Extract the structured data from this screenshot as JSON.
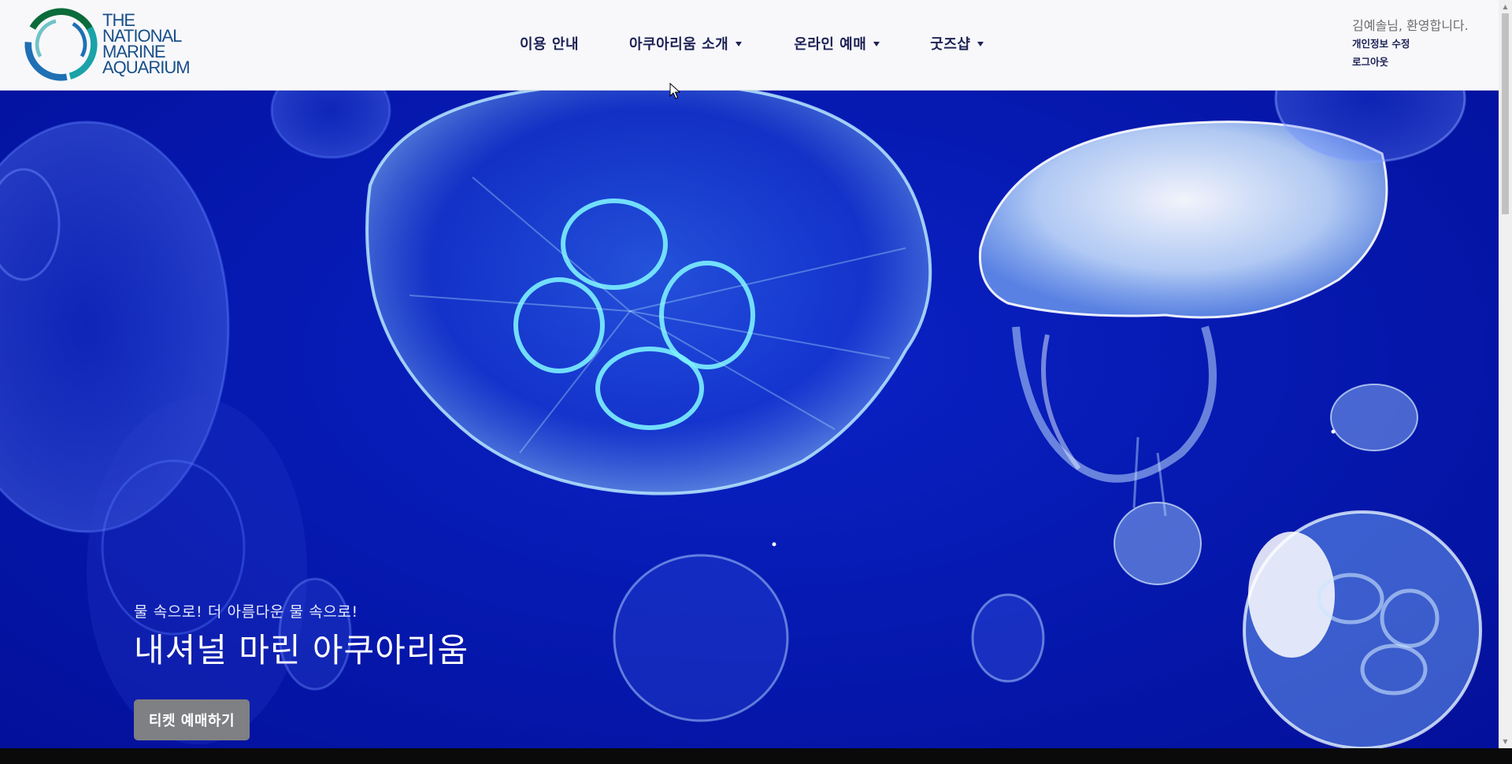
{
  "brand": {
    "logo_lines": [
      "THE",
      "NATIONAL",
      "MARINE",
      "AQUARIUM"
    ],
    "text_color": "#184f88",
    "ring_colors": [
      "#0b6b3a",
      "#1aa3a8",
      "#1f6fb4"
    ]
  },
  "nav": {
    "items": [
      {
        "label": "이용 안내",
        "has_dropdown": false
      },
      {
        "label": "아쿠아리움 소개",
        "has_dropdown": true
      },
      {
        "label": "온라인 예매",
        "has_dropdown": true
      },
      {
        "label": "굿즈샵",
        "has_dropdown": true
      }
    ]
  },
  "user": {
    "welcome": "김예솔님, 환영합니다.",
    "edit_profile": "개인정보 수정",
    "logout": "로그아웃"
  },
  "hero": {
    "subtitle": "물 속으로! 더 아름다운 물 속으로!",
    "title": "내셔널 마린 아쿠아리움",
    "cta_label": "티켓 예매하기",
    "background_color": "#0619b8",
    "cta_color": "#7f8084"
  },
  "icons": {
    "caret": "caret-down-icon",
    "cursor": "mouse-pointer-icon"
  }
}
